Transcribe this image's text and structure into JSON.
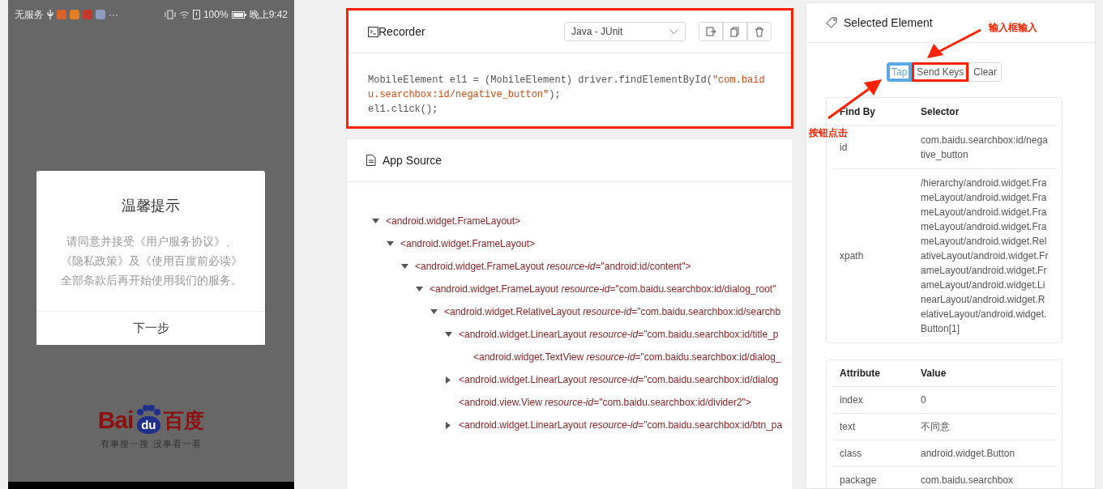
{
  "phone": {
    "status_bar": {
      "carrier": "无服务",
      "more": "···",
      "battery": "100%",
      "time": "晚上9:42"
    },
    "dialog": {
      "title": "温馨提示",
      "message": "请同意并接受《用户服务协议》、《隐私政策》及《使用百度前必读》全部条款后再开始使用我们的服务。",
      "button": "下一步"
    },
    "logo": {
      "left": "Bai",
      "mark": "du",
      "right": "百度",
      "tagline": "有事搜一搜 没事看一看"
    }
  },
  "recorder": {
    "title": "Recorder",
    "highlighted": true,
    "language": "Java - JUnit",
    "code": [
      [
        {
          "kind": "plain",
          "text": "MobileElement el1 = (MobileElement) driver.findElementById("
        },
        {
          "kind": "string",
          "text": "\"com.baidu.searchbox:id/negative_button\""
        },
        {
          "kind": "plain",
          "text": ");"
        }
      ],
      [
        {
          "kind": "plain",
          "text": "el1.click();"
        }
      ]
    ]
  },
  "app_source": {
    "title": "App Source",
    "tree": [
      {
        "kind": "branch",
        "expanded": true,
        "label": "<android.widget.FrameLayout>",
        "children": [
          {
            "kind": "branch",
            "expanded": true,
            "label": "<android.widget.FrameLayout>",
            "children": [
              {
                "kind": "branch",
                "expanded": true,
                "label": "<android.widget.FrameLayout *resource-id*=\"android:id/content\">",
                "children": [
                  {
                    "kind": "branch",
                    "expanded": true,
                    "label": "<android.widget.FrameLayout *resource-id*=\"com.baidu.searchbox:id/dialog_root\"",
                    "children": [
                      {
                        "kind": "branch",
                        "expanded": true,
                        "label": "<android.widget.RelativeLayout *resource-id*=\"com.baidu.searchbox:id/searchb",
                        "children": [
                          {
                            "kind": "branch",
                            "expanded": true,
                            "label": "<android.widget.LinearLayout *resource-id*=\"com.baidu.searchbox:id/title_p",
                            "children": [
                              {
                                "kind": "leaf",
                                "label": "<android.widget.TextView *resource-id*=\"com.baidu.searchbox:id/dialog_"
                              }
                            ]
                          },
                          {
                            "kind": "branch",
                            "expanded": false,
                            "label": "<android.widget.LinearLayout *resource-id*=\"com.baidu.searchbox:id/dialog"
                          },
                          {
                            "kind": "leaf",
                            "label": "<android.view.View *resource-id*=\"com.baidu.searchbox:id/divider2\">"
                          },
                          {
                            "kind": "branch",
                            "expanded": false,
                            "label": "<android.widget.LinearLayout *resource-id*=\"com.baidu.searchbox:id/btn_pa"
                          }
                        ]
                      }
                    ]
                  }
                ]
              }
            ]
          }
        ]
      }
    ]
  },
  "selected_element": {
    "title": "Selected Element",
    "actions": [
      {
        "label": "Tap",
        "selected": true,
        "highlighted": true
      },
      {
        "label": "Send Keys",
        "selected": false,
        "highlighted": true
      },
      {
        "label": "Clear",
        "selected": false,
        "highlighted": false
      }
    ],
    "selectors": {
      "columns": [
        "Find By",
        "Selector"
      ],
      "rows": [
        [
          "id",
          "com.baidu.searchbox:id/negative_button"
        ],
        [
          "xpath",
          "/hierarchy/android.widget.FrameLayout/android.widget.FrameLayout/android.widget.FrameLayout/android.widget.FrameLayout/android.widget.RelativeLayout/android.widget.FrameLayout/android.widget.FrameLayout/android.widget.LinearLayout/android.widget.RelativeLayout/android.widget.Button[1]"
        ]
      ]
    },
    "attributes": {
      "columns": [
        "Attribute",
        "Value"
      ],
      "rows": [
        [
          "index",
          "0"
        ],
        [
          "text",
          "不同意"
        ],
        [
          "class",
          "android.widget.Button"
        ],
        [
          "package",
          "com.baidu.searchbox"
        ]
      ]
    }
  },
  "annotations": [
    {
      "kind": "send-keys",
      "text": "输入框输入"
    },
    {
      "kind": "tap",
      "text": "按钮点击"
    }
  ]
}
